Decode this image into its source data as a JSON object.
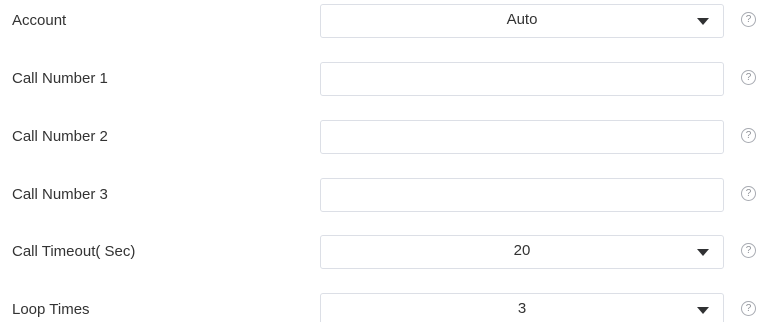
{
  "form": {
    "rows": [
      {
        "label": "Account",
        "type": "select",
        "value": "Auto",
        "help_icon": "question-circle-icon"
      },
      {
        "label": "Call Number 1",
        "type": "text",
        "value": "",
        "help_icon": "question-circle-icon"
      },
      {
        "label": "Call Number 2",
        "type": "text",
        "value": "",
        "help_icon": "question-circle-icon"
      },
      {
        "label": "Call Number 3",
        "type": "text",
        "value": "",
        "help_icon": "question-circle-icon"
      },
      {
        "label": "Call Timeout( Sec)",
        "type": "select",
        "value": "20",
        "help_icon": "question-circle-icon"
      },
      {
        "label": "Loop Times",
        "type": "select",
        "value": "3",
        "help_icon": "question-circle-icon"
      }
    ],
    "help_glyph": "?"
  },
  "colors": {
    "border": "#dcdfe6",
    "text": "#333333",
    "caret": "#303133",
    "help_icon": "#a8abb2"
  }
}
